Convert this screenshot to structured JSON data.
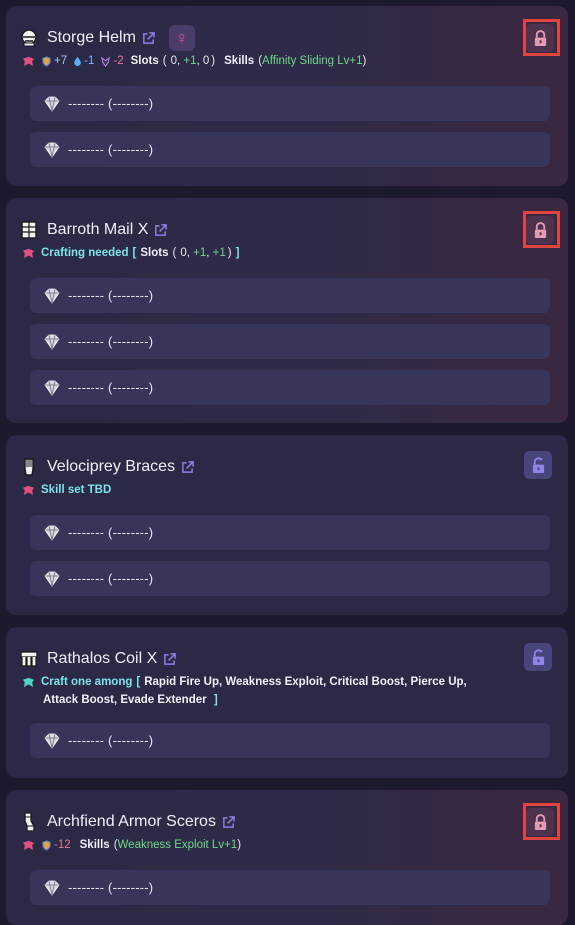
{
  "pieces": [
    {
      "name": "Storge Helm",
      "gender_symbol": "♀",
      "locked": true,
      "stats": {
        "defense": "+7",
        "water": "-1",
        "dragon": "-2"
      },
      "slots_label": "Slots",
      "slots_open": "(",
      "slots": [
        "0",
        "+1",
        "0"
      ],
      "slots_close": ")",
      "skills_label": "Skills",
      "skills_text": "Affinity Sliding Lv+1",
      "decos": [
        "-------- (--------)",
        "-------- (--------)"
      ]
    },
    {
      "name": "Barroth Mail X",
      "locked": true,
      "crafting_label": "Crafting needed",
      "bracket_open": "[",
      "slots_label": "Slots",
      "slots_open": "(",
      "slots": [
        "0",
        "+1",
        "+1"
      ],
      "slots_close": ")",
      "bracket_close": "]",
      "decos": [
        "-------- (--------)",
        "-------- (--------)",
        "-------- (--------)"
      ]
    },
    {
      "name": "Velociprey Braces",
      "locked": false,
      "skill_set_label": "Skill set TBD",
      "decos": [
        "-------- (--------)",
        "-------- (--------)"
      ]
    },
    {
      "name": "Rathalos Coil X",
      "locked": false,
      "craft_label": "Craft one among",
      "bracket_open": "[",
      "options_line1": "Rapid Fire Up, Weakness Exploit, Critical Boost, Pierce Up,",
      "options_line2": "Attack Boost, Evade Extender",
      "bracket_close": "]",
      "decos": [
        "-------- (--------)"
      ]
    },
    {
      "name": "Archfiend Armor Sceros",
      "locked": true,
      "stats": {
        "defense": "-12"
      },
      "skills_label": "Skills",
      "skills_text": "Weakness Exploit Lv+1",
      "decos": [
        "-------- (--------)"
      ]
    }
  ],
  "colors": {
    "background": "#1d1a2e",
    "card": "#2b2945",
    "slot_row": "#37355a",
    "skill_green": "#6fd98a",
    "craft_cyan": "#7ee3e9",
    "highlight_red": "#e0453f",
    "lock_active": "#e39ab5",
    "lock_inactive": "#8f86e8"
  },
  "icons": [
    "helm-icon",
    "chest-icon",
    "arms-icon",
    "waist-icon",
    "legs-icon",
    "external-link-icon",
    "female-icon",
    "lock-icon",
    "unlock-icon",
    "decoration-icon",
    "defense-icon",
    "water-icon",
    "dragon-icon"
  ]
}
